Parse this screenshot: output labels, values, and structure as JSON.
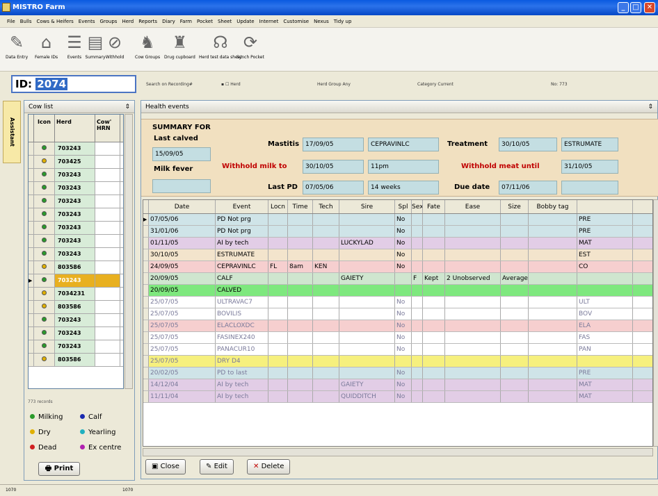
{
  "window": {
    "title": "MISTRO Farm"
  },
  "menu": [
    "File",
    "Bulls",
    "Cows & Heifers",
    "Events",
    "Groups",
    "Herd",
    "Reports",
    "Diary",
    "Farm",
    "Pocket",
    "Sheet",
    "Update",
    "Internet",
    "Customise",
    "Nexus",
    "Tidy up"
  ],
  "toolbar": [
    {
      "label": "Data Entry",
      "icon": "pencil-icon",
      "glyph": "✎"
    },
    {
      "label": "Female IDs",
      "icon": "barn-icon",
      "glyph": "⌂"
    },
    {
      "label": "Events",
      "icon": "list-icon",
      "glyph": "☰"
    },
    {
      "label": "Summary",
      "icon": "summary-icon",
      "glyph": "▤"
    },
    {
      "label": "Withhold",
      "icon": "no-entry-icon",
      "glyph": "⊘"
    },
    {
      "label": "Cow Groups",
      "icon": "cow-groups-icon",
      "glyph": "♞"
    },
    {
      "label": "Drug cupboard",
      "icon": "bottle-icon",
      "glyph": "♜"
    },
    {
      "label": "Herd test data sheet",
      "icon": "herd-test-icon",
      "glyph": "☊"
    },
    {
      "label": "Synch Pocket",
      "icon": "synch-icon",
      "glyph": "⟳"
    }
  ],
  "id_field": {
    "label": "ID:",
    "value": "2074"
  },
  "filters": {
    "search_on": "Search on  Recording#",
    "herd": "Herd",
    "herd_group": "Herd Group  Any",
    "category": "Category  Current",
    "count": "No: 773"
  },
  "sidebar": {
    "assistant": "Assistant"
  },
  "cow_list": {
    "title": "Cow list",
    "headers": [
      "Icon",
      "Herd",
      "Cow' HRN"
    ],
    "rows": [
      {
        "herd": "703243",
        "status": "Milking"
      },
      {
        "herd": "703425",
        "status": "Dry"
      },
      {
        "herd": "703243",
        "status": "Milking"
      },
      {
        "herd": "703243",
        "status": "Milking"
      },
      {
        "herd": "703243",
        "status": "Milking"
      },
      {
        "herd": "703243",
        "status": "Milking"
      },
      {
        "herd": "703243",
        "status": "Milking"
      },
      {
        "herd": "703243",
        "status": "Milking"
      },
      {
        "herd": "703243",
        "status": "Milking"
      },
      {
        "herd": "803586",
        "status": "Dry"
      },
      {
        "herd": "703243",
        "status": "Milking",
        "selected": true
      },
      {
        "herd": "7034231",
        "status": "Dry"
      },
      {
        "herd": "803586",
        "status": "Dry"
      },
      {
        "herd": "703243",
        "status": "Milking"
      },
      {
        "herd": "703243",
        "status": "Milking"
      },
      {
        "herd": "703243",
        "status": "Milking"
      },
      {
        "herd": "803586",
        "status": "Dry"
      }
    ],
    "records": "773 records",
    "legend": [
      {
        "label": "Milking",
        "color": "#2a9a2a"
      },
      {
        "label": "Calf",
        "color": "#1a2ab0"
      },
      {
        "label": "Dry",
        "color": "#e0b000"
      },
      {
        "label": "Yearling",
        "color": "#20b0c0"
      },
      {
        "label": "Dead",
        "color": "#d02020"
      },
      {
        "label": "Ex centre",
        "color": "#b020b0"
      }
    ],
    "print_label": "Print"
  },
  "health": {
    "title": "Health events",
    "summary": {
      "heading": "SUMMARY FOR",
      "last_calved_label": "Last calved",
      "last_calved": "15/09/05",
      "milk_fever_label": "Milk fever",
      "milk_fever": "",
      "mastitis_label": "Mastitis",
      "mastitis_date": "17/09/05",
      "mastitis_drug": "CEPRAVINLC",
      "treatment_label": "Treatment",
      "treatment_date": "30/10/05",
      "treatment_drug": "ESTRUMATE",
      "withhold_milk_label": "Withhold milk to",
      "withhold_milk_date": "30/10/05",
      "withhold_milk_time": "11pm",
      "withhold_meat_label": "Withhold meat until",
      "withhold_meat_date": "31/10/05",
      "last_pd_label": "Last PD",
      "last_pd_date": "07/05/06",
      "last_pd_weeks": "14 weeks",
      "due_date_label": "Due date",
      "due_date": "07/11/06",
      "due_extra": ""
    },
    "headers": [
      "Date",
      "Event",
      "Locn",
      "Time",
      "Tech",
      "Sire",
      "Spl",
      "Sex",
      "Fate",
      "Ease",
      "Size",
      "Bobby tag",
      ""
    ],
    "rows": [
      {
        "cells": [
          "07/05/06",
          "PD Not prg",
          "",
          "",
          "",
          "",
          "No",
          "",
          "",
          "",
          "",
          "",
          "PRE"
        ],
        "bg": "#cfe4e8",
        "current": true
      },
      {
        "cells": [
          "31/01/06",
          "PD Not prg",
          "",
          "",
          "",
          "",
          "No",
          "",
          "",
          "",
          "",
          "",
          "PRE"
        ],
        "bg": "#cfe4e8"
      },
      {
        "cells": [
          "01/11/05",
          "AI by tech",
          "",
          "",
          "",
          "LUCKYLAD",
          "No",
          "",
          "",
          "",
          "",
          "",
          "MAT"
        ],
        "bg": "#e2cde6"
      },
      {
        "cells": [
          "30/10/05",
          "ESTRUMATE",
          "",
          "",
          "",
          "",
          "No",
          "",
          "",
          "",
          "",
          "",
          "EST"
        ],
        "bg": "#f3e4cc"
      },
      {
        "cells": [
          "24/09/05",
          "CEPRAVINLC",
          "FL",
          "8am",
          "KEN",
          "",
          "No",
          "",
          "",
          "",
          "",
          "",
          "CO"
        ],
        "bg": "#f6cfcf"
      },
      {
        "cells": [
          "20/09/05",
          "CALF",
          "",
          "",
          "",
          "GAIETY",
          "",
          "F",
          "Kept",
          "2 Unobserved",
          "Average",
          "",
          ""
        ],
        "bg": "#cfe6cf"
      },
      {
        "cells": [
          "20/09/05",
          "CALVED",
          "",
          "",
          "",
          "",
          "",
          "",
          "",
          "",
          "",
          "",
          ""
        ],
        "bg": "#7ee87e"
      },
      {
        "cells": [
          "25/07/05",
          "ULTRAVAC7",
          "",
          "",
          "",
          "",
          "No",
          "",
          "",
          "",
          "",
          "",
          "ULT"
        ],
        "bg": "#ffffff",
        "faded": true
      },
      {
        "cells": [
          "25/07/05",
          "BOVILIS",
          "",
          "",
          "",
          "",
          "No",
          "",
          "",
          "",
          "",
          "",
          "BOV"
        ],
        "bg": "#ffffff",
        "faded": true
      },
      {
        "cells": [
          "25/07/05",
          "ELACLOXDC",
          "",
          "",
          "",
          "",
          "No",
          "",
          "",
          "",
          "",
          "",
          "ELA"
        ],
        "bg": "#f6cfcf",
        "faded": true
      },
      {
        "cells": [
          "25/07/05",
          "FASINEX240",
          "",
          "",
          "",
          "",
          "No",
          "",
          "",
          "",
          "",
          "",
          "FAS"
        ],
        "bg": "#ffffff",
        "faded": true
      },
      {
        "cells": [
          "25/07/05",
          "PANACUR10",
          "",
          "",
          "",
          "",
          "No",
          "",
          "",
          "",
          "",
          "",
          "PAN"
        ],
        "bg": "#ffffff",
        "faded": true
      },
      {
        "cells": [
          "25/07/05",
          "DRY D4",
          "",
          "",
          "",
          "",
          "",
          "",
          "",
          "",
          "",
          "",
          ""
        ],
        "bg": "#f6f07e",
        "faded": true
      },
      {
        "cells": [
          "20/02/05",
          "PD to last",
          "",
          "",
          "",
          "",
          "No",
          "",
          "",
          "",
          "",
          "",
          "PRE"
        ],
        "bg": "#cfe4e8",
        "faded": true
      },
      {
        "cells": [
          "14/12/04",
          "AI by tech",
          "",
          "",
          "",
          "GAIETY",
          "No",
          "",
          "",
          "",
          "",
          "",
          "MAT"
        ],
        "bg": "#e2cde6",
        "faded": true
      },
      {
        "cells": [
          "11/11/04",
          "AI by tech",
          "",
          "",
          "",
          "QUIDDITCH",
          "No",
          "",
          "",
          "",
          "",
          "",
          "MAT"
        ],
        "bg": "#e2cde6",
        "faded": true
      }
    ],
    "buttons": {
      "close": "Close",
      "edit": "Edit",
      "delete": "Delete"
    }
  },
  "status": {
    "left": "1070",
    "panel": "1070"
  }
}
